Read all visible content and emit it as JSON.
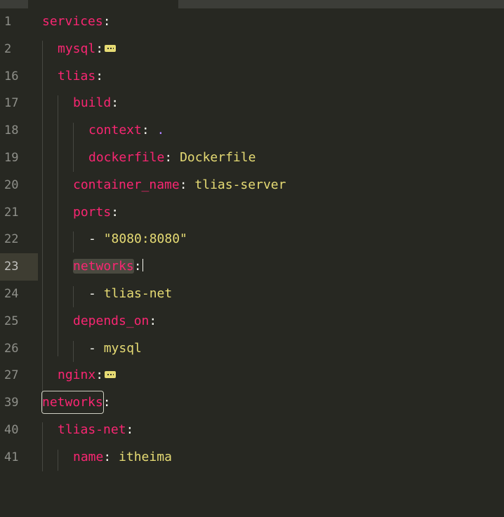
{
  "colors": {
    "background": "#272822",
    "key": "#f92672",
    "string": "#e6db74",
    "line_number": "#8f908a",
    "active_line": "#3e3d32"
  },
  "lines": [
    {
      "num": "1",
      "key": "services",
      "sep": ":",
      "value": ""
    },
    {
      "num": "2",
      "key": "mysql",
      "sep": ":",
      "value": ""
    },
    {
      "num": "16",
      "key": "tlias",
      "sep": ":",
      "value": ""
    },
    {
      "num": "17",
      "key": "build",
      "sep": ":",
      "value": ""
    },
    {
      "num": "18",
      "key": "context",
      "sep": ": ",
      "value": "."
    },
    {
      "num": "19",
      "key": "dockerfile",
      "sep": ": ",
      "value": "Dockerfile"
    },
    {
      "num": "20",
      "key": "container_name",
      "sep": ": ",
      "value": "tlias-server"
    },
    {
      "num": "21",
      "key": "ports",
      "sep": ":",
      "value": ""
    },
    {
      "num": "22",
      "dash": "- ",
      "value": "\"8080:8080\""
    },
    {
      "num": "23",
      "key": "networks",
      "sep": ":",
      "value": ""
    },
    {
      "num": "24",
      "dash": "- ",
      "value": "tlias-net"
    },
    {
      "num": "25",
      "key": "depends_on",
      "sep": ":",
      "value": ""
    },
    {
      "num": "26",
      "dash": "- ",
      "value": "mysql"
    },
    {
      "num": "27",
      "key": "nginx",
      "sep": ":",
      "value": ""
    },
    {
      "num": "39",
      "key": "networks",
      "sep": ":",
      "value": ""
    },
    {
      "num": "40",
      "key": "tlias-net",
      "sep": ":",
      "value": ""
    },
    {
      "num": "41",
      "key": "name",
      "sep": ": ",
      "value": "itheima"
    }
  ]
}
